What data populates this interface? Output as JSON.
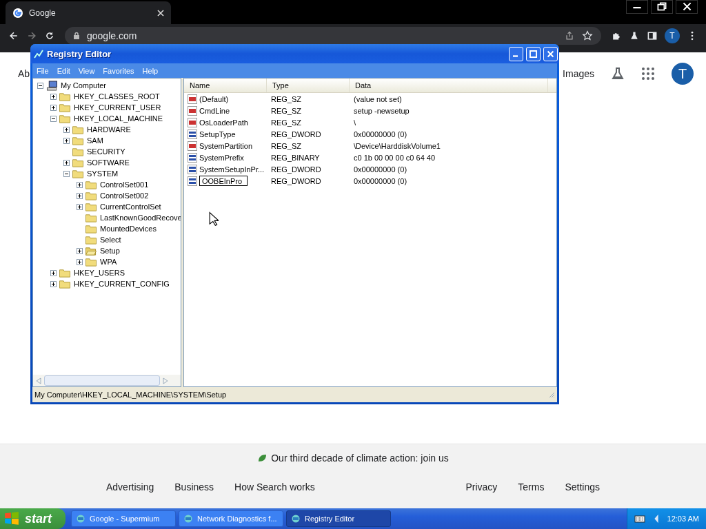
{
  "browser": {
    "tab": {
      "title": "Google"
    },
    "address": "google.com",
    "profile_initial": "T"
  },
  "page": {
    "header_left": "Ab",
    "header_link": "Images",
    "avatar_initial": "T",
    "climate": "Our third decade of climate action: join us",
    "footer_left": [
      "Advertising",
      "Business",
      "How Search works"
    ],
    "footer_right": [
      "Privacy",
      "Terms",
      "Settings"
    ]
  },
  "registry": {
    "title": "Registry Editor",
    "menu": [
      "File",
      "Edit",
      "View",
      "Favorites",
      "Help"
    ],
    "tree": [
      {
        "label": "My Computer",
        "kind": "computer",
        "expandable": true,
        "expanded": true,
        "selected": false,
        "children": [
          {
            "label": "HKEY_CLASSES_ROOT",
            "expandable": true,
            "expanded": false,
            "selected": false
          },
          {
            "label": "HKEY_CURRENT_USER",
            "expandable": true,
            "expanded": false,
            "selected": false
          },
          {
            "label": "HKEY_LOCAL_MACHINE",
            "expandable": true,
            "expanded": true,
            "selected": false,
            "children": [
              {
                "label": "HARDWARE",
                "expandable": true,
                "expanded": false,
                "selected": false
              },
              {
                "label": "SAM",
                "expandable": true,
                "expanded": false,
                "selected": false
              },
              {
                "label": "SECURITY",
                "expandable": false,
                "expanded": false,
                "selected": false
              },
              {
                "label": "SOFTWARE",
                "expandable": true,
                "expanded": false,
                "selected": false
              },
              {
                "label": "SYSTEM",
                "expandable": true,
                "expanded": true,
                "selected": false,
                "children": [
                  {
                    "label": "ControlSet001",
                    "expandable": true,
                    "expanded": false,
                    "selected": false
                  },
                  {
                    "label": "ControlSet002",
                    "expandable": true,
                    "expanded": false,
                    "selected": false
                  },
                  {
                    "label": "CurrentControlSet",
                    "expandable": true,
                    "expanded": false,
                    "selected": false
                  },
                  {
                    "label": "LastKnownGoodRecove",
                    "expandable": false,
                    "expanded": false,
                    "selected": false
                  },
                  {
                    "label": "MountedDevices",
                    "expandable": false,
                    "expanded": false,
                    "selected": false
                  },
                  {
                    "label": "Select",
                    "expandable": false,
                    "expanded": false,
                    "selected": false
                  },
                  {
                    "label": "Setup",
                    "expandable": true,
                    "expanded": false,
                    "selected": true
                  },
                  {
                    "label": "WPA",
                    "expandable": true,
                    "expanded": false,
                    "selected": false
                  }
                ]
              }
            ]
          },
          {
            "label": "HKEY_USERS",
            "expandable": true,
            "expanded": false,
            "selected": false
          },
          {
            "label": "HKEY_CURRENT_CONFIG",
            "expandable": true,
            "expanded": false,
            "selected": false
          }
        ]
      }
    ],
    "columns": [
      "Name",
      "Type",
      "Data"
    ],
    "rows": [
      {
        "kind": "string",
        "name": "(Default)",
        "type": "REG_SZ",
        "data": "(value not set)",
        "editing": false
      },
      {
        "kind": "string",
        "name": "CmdLine",
        "type": "REG_SZ",
        "data": "setup -newsetup",
        "editing": false
      },
      {
        "kind": "string",
        "name": "OsLoaderPath",
        "type": "REG_SZ",
        "data": "\\",
        "editing": false
      },
      {
        "kind": "binary",
        "name": "SetupType",
        "type": "REG_DWORD",
        "data": "0x00000000 (0)",
        "editing": false
      },
      {
        "kind": "string",
        "name": "SystemPartition",
        "type": "REG_SZ",
        "data": "\\Device\\HarddiskVolume1",
        "editing": false
      },
      {
        "kind": "binary",
        "name": "SystemPrefix",
        "type": "REG_BINARY",
        "data": "c0 1b 00 00 00 c0 64 40",
        "editing": false
      },
      {
        "kind": "binary",
        "name": "SystemSetupInPr...",
        "type": "REG_DWORD",
        "data": "0x00000000 (0)",
        "editing": false
      },
      {
        "kind": "binary",
        "name": "OOBEInPro",
        "type": "REG_DWORD",
        "data": "0x00000000 (0)",
        "editing": true
      }
    ],
    "status": "My Computer\\HKEY_LOCAL_MACHINE\\SYSTEM\\Setup"
  },
  "taskbar": {
    "start": "start",
    "tasks": [
      {
        "label": "Google - Supermium",
        "selected": false
      },
      {
        "label": "Network Diagnostics f...",
        "selected": false
      },
      {
        "label": "Registry Editor",
        "selected": true
      }
    ],
    "clock": "12:03 AM"
  }
}
